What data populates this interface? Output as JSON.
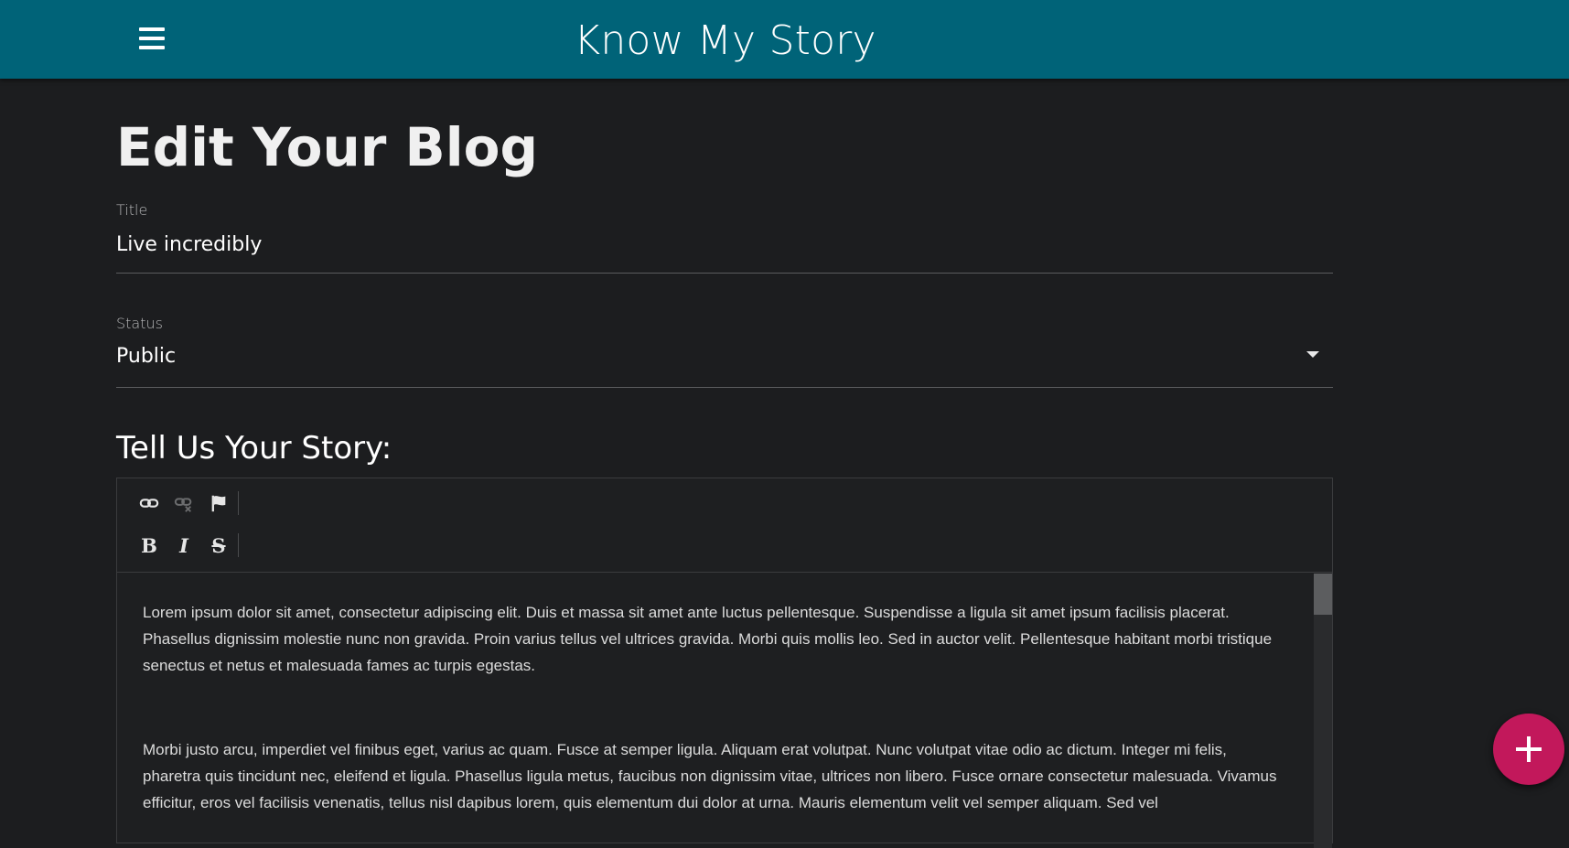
{
  "appbar": {
    "title": "Know My Story",
    "menu_icon": "hamburger-menu-icon"
  },
  "page": {
    "title": "Edit Your Blog"
  },
  "form": {
    "title_label": "Title",
    "title_value": "Live incredibly",
    "status_label": "Status",
    "status_value": "Public",
    "status_options": [
      "Public"
    ]
  },
  "editor": {
    "heading": "Tell Us Your Story:",
    "toolbar_row1": [
      "link-icon",
      "unlink-icon",
      "flag-icon"
    ],
    "toolbar_row2": [
      {
        "name": "bold",
        "label": "B"
      },
      {
        "name": "italic",
        "label": "I"
      },
      {
        "name": "strikethrough",
        "label": "S"
      }
    ],
    "paragraphs": [
      "Lorem ipsum dolor sit amet, consectetur adipiscing elit. Duis et massa sit amet ante luctus pellentesque. Suspendisse a ligula sit amet ipsum facilisis placerat. Phasellus dignissim molestie nunc non gravida. Proin varius tellus vel ultrices gravida. Morbi quis mollis leo. Sed in auctor velit. Pellentesque habitant morbi tristique senectus et netus et malesuada fames ac turpis egestas.",
      "Morbi justo arcu, imperdiet vel finibus eget, varius ac quam. Fusce at semper ligula. Aliquam erat volutpat. Nunc volutpat vitae odio ac dictum. Integer mi felis, pharetra quis tincidunt nec, eleifend et ligula. Phasellus ligula metus, faucibus non dignissim vitae, ultrices non libero. Fusce ornare consectetur malesuada. Vivamus efficitur, eros vel facilisis venenatis, tellus nisl dapibus lorem, quis elementum dui dolor at urna. Mauris elementum velit vel semper aliquam. Sed vel"
    ]
  },
  "fab": {
    "icon": "plus-icon"
  },
  "colors": {
    "appbar": "#006378",
    "background": "#1c1d1f",
    "fab": "#c2185b"
  }
}
